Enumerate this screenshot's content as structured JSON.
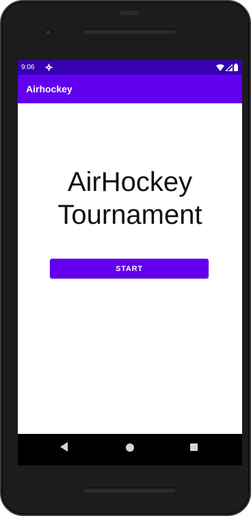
{
  "status_bar": {
    "time": "9:06",
    "settings_icon": "gear-icon",
    "wifi_icon": "wifi-icon",
    "signal_icon": "signal-icon",
    "battery_icon": "battery-icon"
  },
  "app_bar": {
    "title": "Airhockey"
  },
  "main": {
    "headline_line1": "AirHockey",
    "headline_line2": "Tournament",
    "start_button_label": "START"
  },
  "nav_bar": {
    "back_icon": "back-icon",
    "home_icon": "home-icon",
    "recents_icon": "recents-icon"
  },
  "colors": {
    "status_bar": "#3700b3",
    "primary": "#6200ee",
    "background": "#ffffff",
    "text": "#111111"
  }
}
